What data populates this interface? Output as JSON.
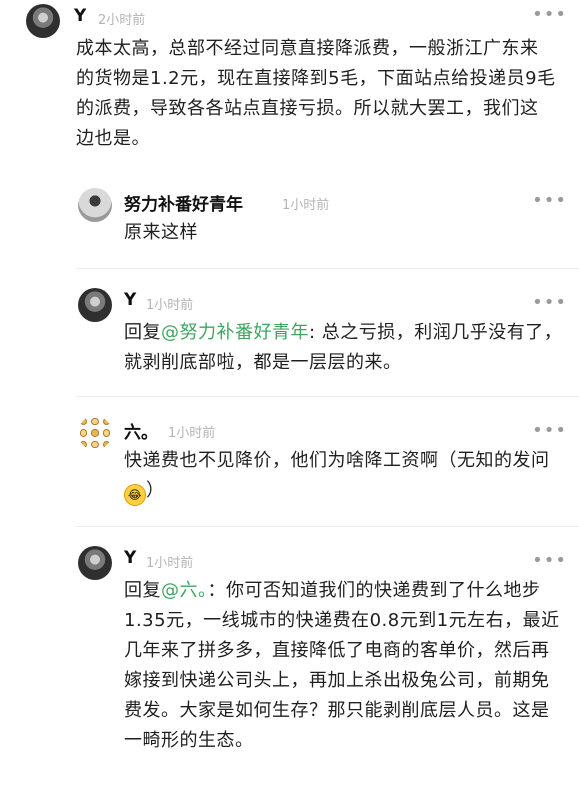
{
  "comments": [
    {
      "user": "Y",
      "time": "2小时前",
      "more": "•••",
      "text": "成本太高，总部不经过同意直接降派费，一般浙江广东来的货物是1.2元，现在直接降到5毛，下面站点给投递员9毛的派费，导致各各站点直接亏损。所以就大罢工，我们这边也是。"
    },
    {
      "user": "努力补番好青年",
      "time": "1小时前",
      "more": "•••",
      "text": "原来这样"
    },
    {
      "user": "Y",
      "time": "1小时前",
      "more": "•••",
      "reply_prefix": "回复",
      "mention": "@努力补番好青年",
      "text": ": 总之亏损，利润几乎没有了，就剥削底部啦，都是一层层的来。"
    },
    {
      "user": "六。",
      "time": "1小时前",
      "more": "•••",
      "text": "快递费也不见降价，他们为啥降工资啊（无知的发问",
      "emoji": "😂",
      "text_end": "）"
    },
    {
      "user": "Y",
      "time": "1小时前",
      "more": "•••",
      "reply_prefix": "回复",
      "mention": "@六。",
      "text": "：你可否知道我们的快递费到了什么地步1.35元，一线城市的快递费在0.8元到1元左右，最近几年来了拼多多，直接降低了电商的客单价，然后再嫁接到快递公司头上，再加上杀出极兔公司，前期免费发。大家是如何生存？那只能剥削底层人员。这是一畸形的生态。"
    }
  ]
}
